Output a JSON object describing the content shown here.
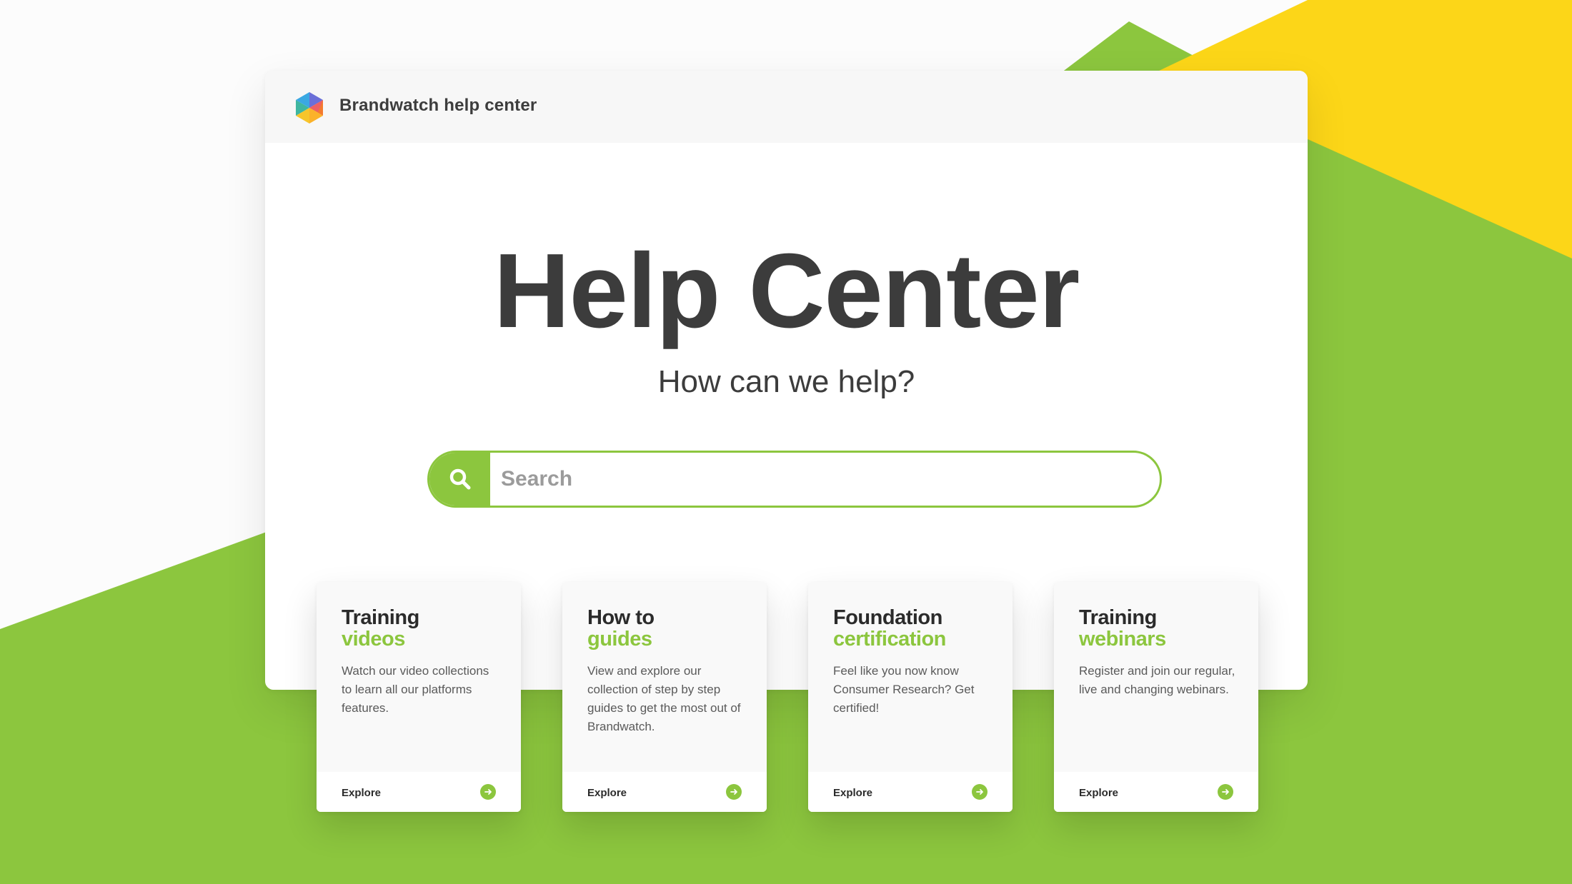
{
  "colors": {
    "accent": "#8cc63e",
    "yellow": "#fcd618",
    "text_dark": "#3c3c3c",
    "header_bg": "#f7f7f7"
  },
  "header": {
    "logo_icon": "hexagon-logo-icon",
    "title": "Brandwatch help center"
  },
  "hero": {
    "title": "Help Center",
    "subtitle": "How can we help?"
  },
  "search": {
    "icon": "search-icon",
    "placeholder": "Search",
    "value": ""
  },
  "cards": [
    {
      "title_line1": "Training",
      "title_line2": "videos",
      "description": "Watch our video collections to learn all our platforms features.",
      "action_label": "Explore",
      "action_icon": "arrow-right-icon"
    },
    {
      "title_line1": "How to",
      "title_line2": "guides",
      "description": "View and explore our collection of step by step guides to get the most out of Brandwatch.",
      "action_label": "Explore",
      "action_icon": "arrow-right-icon"
    },
    {
      "title_line1": "Foundation",
      "title_line2": "certification",
      "description": "Feel like you now know Consumer Research? Get certified!",
      "action_label": "Explore",
      "action_icon": "arrow-right-icon"
    },
    {
      "title_line1": "Training",
      "title_line2": "webinars",
      "description": "Register and join our regular, live and changing webinars.",
      "action_label": "Explore",
      "action_icon": "arrow-right-icon"
    }
  ]
}
